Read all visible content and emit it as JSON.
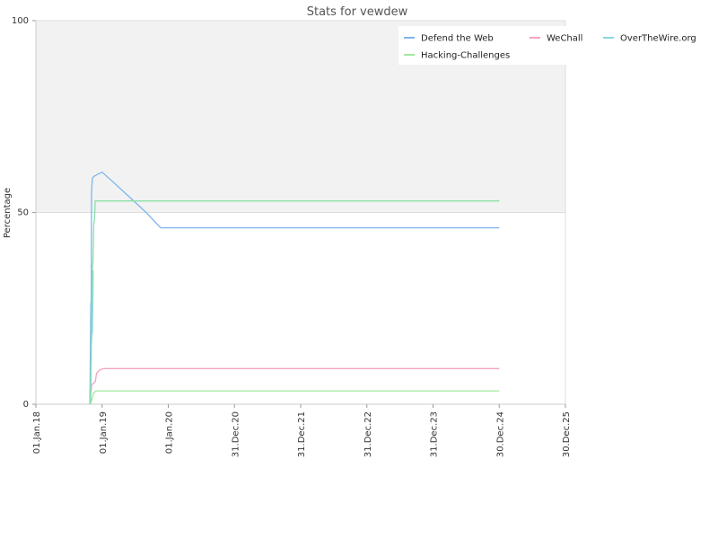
{
  "chart_data": {
    "type": "line",
    "title": "Stats for vewdew",
    "xlabel": "",
    "ylabel": "Percentage",
    "ylim": [
      0,
      100
    ],
    "y_ticks": [
      "0",
      "50",
      "100"
    ],
    "xlim": [
      "2018-01-01",
      "2025-12-30"
    ],
    "x_ticks": [
      {
        "label": "01.Jan.18",
        "date": "2018-01-01"
      },
      {
        "label": "01.Jan.19",
        "date": "2019-01-01"
      },
      {
        "label": "01.Jan.20",
        "date": "2020-01-01"
      },
      {
        "label": "31.Dec.20",
        "date": "2020-12-31"
      },
      {
        "label": "31.Dec.21",
        "date": "2021-12-31"
      },
      {
        "label": "31.Dec.22",
        "date": "2022-12-31"
      },
      {
        "label": "31.Dec.23",
        "date": "2023-12-31"
      },
      {
        "label": "30.Dec.24",
        "date": "2024-12-30"
      },
      {
        "label": "30.Dec.25",
        "date": "2025-12-30"
      }
    ],
    "plot_background": "#f2f2f2",
    "grid": true,
    "legend_position": "top-right",
    "series": [
      {
        "name": "Defend the Web",
        "color": "#7eb6ec",
        "points": [
          [
            "2018-10-25",
            0
          ],
          [
            "2018-10-27",
            5
          ],
          [
            "2018-10-29",
            17
          ],
          [
            "2018-10-31",
            26
          ],
          [
            "2018-11-02",
            27
          ],
          [
            "2018-11-04",
            55
          ],
          [
            "2018-11-06",
            57
          ],
          [
            "2018-11-09",
            59
          ],
          [
            "2018-11-20",
            59.5
          ],
          [
            "2018-12-10",
            60
          ],
          [
            "2019-01-01",
            60.5
          ],
          [
            "2019-03-01",
            58
          ],
          [
            "2019-06-01",
            54
          ],
          [
            "2019-09-01",
            50
          ],
          [
            "2019-11-20",
            46
          ],
          [
            "2024-12-30",
            46
          ]
        ]
      },
      {
        "name": "WeChall",
        "color": "#f4a3c0",
        "points": [
          [
            "2018-10-26",
            0
          ],
          [
            "2018-11-05",
            5
          ],
          [
            "2018-11-25",
            6
          ],
          [
            "2018-12-01",
            8
          ],
          [
            "2018-12-20",
            9
          ],
          [
            "2019-01-10",
            9.3
          ],
          [
            "2024-12-30",
            9.3
          ]
        ]
      },
      {
        "name": "OverTheWire.org",
        "color": "#8ad8e4",
        "points": [
          [
            "2018-10-26",
            0
          ],
          [
            "2018-10-30",
            5
          ],
          [
            "2018-11-03",
            15
          ],
          [
            "2018-11-06",
            18
          ],
          [
            "2018-11-09",
            19
          ],
          [
            "2018-11-11",
            26
          ],
          [
            "2018-11-13",
            35
          ]
        ]
      },
      {
        "name": "Hacking-Challenges",
        "color": "#a2e89c",
        "points": [
          [
            "2018-10-26",
            0
          ],
          [
            "2018-11-05",
            1
          ],
          [
            "2018-11-15",
            3
          ],
          [
            "2018-12-01",
            3.5
          ],
          [
            "2024-12-30",
            3.5
          ]
        ]
      },
      {
        "name": "",
        "color": "#8ae0a8",
        "points": [
          [
            "2018-10-30",
            0
          ],
          [
            "2018-11-04",
            20
          ],
          [
            "2018-11-08",
            35
          ],
          [
            "2018-11-12",
            37
          ],
          [
            "2018-11-16",
            47
          ],
          [
            "2018-11-20",
            48
          ],
          [
            "2018-11-24",
            53
          ],
          [
            "2024-12-30",
            53
          ]
        ]
      }
    ],
    "legend": [
      {
        "label": "Defend the Web",
        "color": "#7eb6ec"
      },
      {
        "label": "WeChall",
        "color": "#f4a3c0"
      },
      {
        "label": "OverTheWire.org",
        "color": "#8ad8e4"
      },
      {
        "label": "Hacking-Challenges",
        "color": "#a2e89c"
      }
    ]
  }
}
